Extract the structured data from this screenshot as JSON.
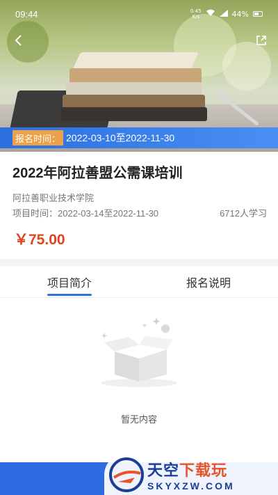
{
  "status_bar": {
    "time": "09:44",
    "net_speed_value": "0.45",
    "net_speed_unit": "K/s",
    "battery_percent": "44%"
  },
  "header": {
    "back_icon": "back-arrow-icon",
    "share_icon": "share-icon"
  },
  "registration": {
    "label": "报名时间：",
    "value": "2022-03-10至2022-11-30"
  },
  "course": {
    "title": "2022年阿拉善盟公需课培训",
    "organization": "阿拉善职业技术学院",
    "period": "项目时间：2022-03-14至2022-11-30",
    "learners": "6712人学习",
    "price": "￥75.00"
  },
  "tabs": [
    {
      "label": "项目简介",
      "active": true
    },
    {
      "label": "报名说明",
      "active": false
    }
  ],
  "empty_state": {
    "text": "暂无内容",
    "icon": "empty-box-icon"
  },
  "watermark": {
    "brand_main": "天空",
    "brand_accent": "下载玩",
    "domain": "SKYXZW.COM"
  },
  "colors": {
    "primary": "#2b6fe0",
    "price": "#e0451f",
    "badge": "#efa14a"
  }
}
